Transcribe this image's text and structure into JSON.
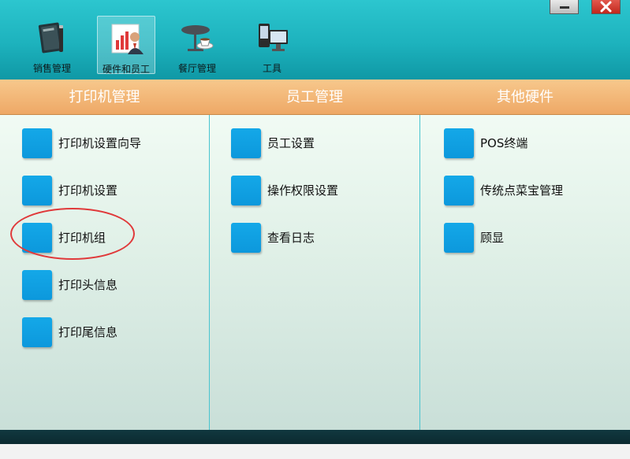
{
  "toolbar": {
    "items": [
      {
        "label": "销售管理",
        "icon": "sales-book-icon",
        "active": false
      },
      {
        "label": "硬件和员工",
        "icon": "hardware-staff-icon",
        "active": true
      },
      {
        "label": "餐厅管理",
        "icon": "restaurant-table-icon",
        "active": false
      },
      {
        "label": "工具",
        "icon": "tools-devices-icon",
        "active": false
      }
    ],
    "window_controls": [
      "minimize-icon",
      "close-icon"
    ]
  },
  "columns": [
    {
      "title": "打印机管理",
      "items": [
        {
          "label": "打印机设置向导"
        },
        {
          "label": "打印机设置"
        },
        {
          "label": "打印机组"
        },
        {
          "label": "打印头信息"
        },
        {
          "label": "打印尾信息"
        }
      ]
    },
    {
      "title": "员工管理",
      "items": [
        {
          "label": "员工设置"
        },
        {
          "label": "操作权限设置"
        },
        {
          "label": "查看日志"
        }
      ]
    },
    {
      "title": "其他硬件",
      "items": [
        {
          "label": "POS终端"
        },
        {
          "label": "传统点菜宝管理"
        },
        {
          "label": "顾显"
        }
      ]
    }
  ],
  "colors": {
    "toolbar": "#1db2bd",
    "header_band": "#eea866",
    "tile": "#0c98dc",
    "divider": "#48c4cf",
    "highlight_ring": "#e0393a",
    "status_bar": "#0b2a30"
  }
}
